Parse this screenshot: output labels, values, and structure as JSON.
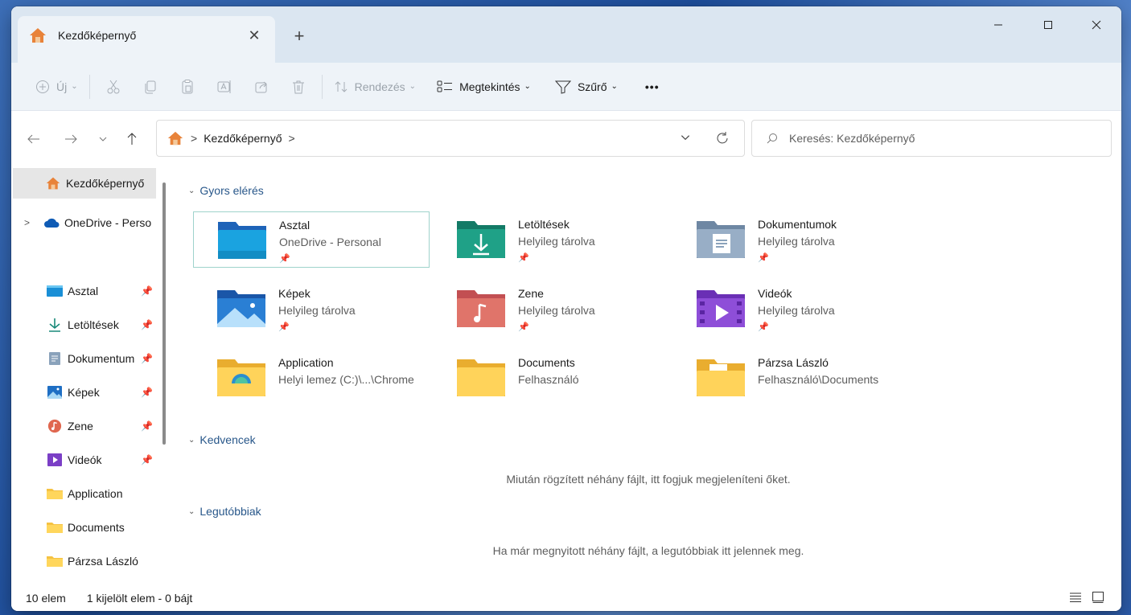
{
  "tab": {
    "title": "Kezdőképernyő"
  },
  "commands": {
    "new_label": "Új",
    "sort_label": "Rendezés",
    "view_label": "Megtekintés",
    "filter_label": "Szűrő",
    "more_label": "•••"
  },
  "address": {
    "crumb": "Kezdőképernyő",
    "sep": ">"
  },
  "search": {
    "placeholder": "Keresés: Kezdőképernyő"
  },
  "sidebar": {
    "items": [
      {
        "label": "Kezdőképernyő",
        "icon": "home-icon"
      },
      {
        "label": "OneDrive - Perso",
        "icon": "onedrive-icon"
      },
      {
        "label": "Asztal",
        "icon": "desktop-icon"
      },
      {
        "label": "Letöltések",
        "icon": "download-icon"
      },
      {
        "label": "Dokumentum",
        "icon": "documents-icon"
      },
      {
        "label": "Képek",
        "icon": "pictures-icon"
      },
      {
        "label": "Zene",
        "icon": "music-icon"
      },
      {
        "label": "Videók",
        "icon": "videos-icon"
      },
      {
        "label": "Application",
        "icon": "folder-icon"
      },
      {
        "label": "Documents",
        "icon": "folder-icon"
      },
      {
        "label": "Párzsa László",
        "icon": "folder-icon"
      }
    ]
  },
  "sections": {
    "quick": "Gyors elérés",
    "favorites": "Kedvencek",
    "recent": "Legutóbbiak"
  },
  "quick_access": [
    {
      "name": "Asztal",
      "sub": "OneDrive - Personal",
      "pinned": true,
      "icon": "desktop-folder-icon"
    },
    {
      "name": "Letöltések",
      "sub": "Helyileg tárolva",
      "pinned": true,
      "icon": "downloads-folder-icon"
    },
    {
      "name": "Dokumentumok",
      "sub": "Helyileg tárolva",
      "pinned": true,
      "icon": "documents-folder-icon"
    },
    {
      "name": "Képek",
      "sub": "Helyileg tárolva",
      "pinned": true,
      "icon": "pictures-folder-icon"
    },
    {
      "name": "Zene",
      "sub": "Helyileg tárolva",
      "pinned": true,
      "icon": "music-folder-icon"
    },
    {
      "name": "Videók",
      "sub": "Helyileg tárolva",
      "pinned": true,
      "icon": "videos-folder-icon"
    },
    {
      "name": "Application",
      "sub": "Helyi lemez (C:)\\...\\Chrome",
      "pinned": false,
      "icon": "app-folder-icon"
    },
    {
      "name": "Documents",
      "sub": "Felhasználó",
      "pinned": false,
      "icon": "folder-icon"
    },
    {
      "name": "Párzsa László",
      "sub": "Felhasználó\\Documents",
      "pinned": false,
      "icon": "folder-icon"
    }
  ],
  "messages": {
    "favorites_empty": "Miután rögzített néhány fájlt, itt fogjuk megjeleníteni őket.",
    "recent_empty": "Ha már megnyitott néhány fájlt, a legutóbbiak itt jelennek meg."
  },
  "status": {
    "count": "10 elem",
    "selection": "1 kijelölt elem - 0 bájt"
  },
  "colors": {
    "accent": "#0067c0",
    "section": "#28578a",
    "titlebar": "#dbe6f1",
    "cmdbar": "#eef3f8"
  }
}
